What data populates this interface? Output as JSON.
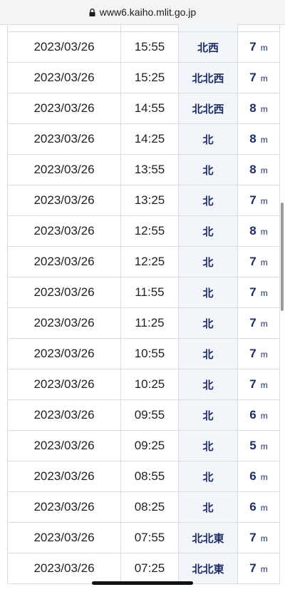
{
  "browser": {
    "url": "www6.kaiho.mlit.go.jp"
  },
  "rows": [
    {
      "date": "2023/03/26",
      "time": "15:55",
      "direction": "北西",
      "height": "7",
      "unit": "m"
    },
    {
      "date": "2023/03/26",
      "time": "15:25",
      "direction": "北北西",
      "height": "7",
      "unit": "m"
    },
    {
      "date": "2023/03/26",
      "time": "14:55",
      "direction": "北北西",
      "height": "8",
      "unit": "m"
    },
    {
      "date": "2023/03/26",
      "time": "14:25",
      "direction": "北",
      "height": "8",
      "unit": "m"
    },
    {
      "date": "2023/03/26",
      "time": "13:55",
      "direction": "北",
      "height": "8",
      "unit": "m"
    },
    {
      "date": "2023/03/26",
      "time": "13:25",
      "direction": "北",
      "height": "7",
      "unit": "m"
    },
    {
      "date": "2023/03/26",
      "time": "12:55",
      "direction": "北",
      "height": "8",
      "unit": "m"
    },
    {
      "date": "2023/03/26",
      "time": "12:25",
      "direction": "北",
      "height": "7",
      "unit": "m"
    },
    {
      "date": "2023/03/26",
      "time": "11:55",
      "direction": "北",
      "height": "7",
      "unit": "m"
    },
    {
      "date": "2023/03/26",
      "time": "11:25",
      "direction": "北",
      "height": "7",
      "unit": "m"
    },
    {
      "date": "2023/03/26",
      "time": "10:55",
      "direction": "北",
      "height": "7",
      "unit": "m"
    },
    {
      "date": "2023/03/26",
      "time": "10:25",
      "direction": "北",
      "height": "7",
      "unit": "m"
    },
    {
      "date": "2023/03/26",
      "time": "09:55",
      "direction": "北",
      "height": "6",
      "unit": "m"
    },
    {
      "date": "2023/03/26",
      "time": "09:25",
      "direction": "北",
      "height": "5",
      "unit": "m"
    },
    {
      "date": "2023/03/26",
      "time": "08:55",
      "direction": "北",
      "height": "6",
      "unit": "m"
    },
    {
      "date": "2023/03/26",
      "time": "08:25",
      "direction": "北",
      "height": "6",
      "unit": "m"
    },
    {
      "date": "2023/03/26",
      "time": "07:55",
      "direction": "北北東",
      "height": "7",
      "unit": "m"
    },
    {
      "date": "2023/03/26",
      "time": "07:25",
      "direction": "北北東",
      "height": "7",
      "unit": "m"
    }
  ]
}
